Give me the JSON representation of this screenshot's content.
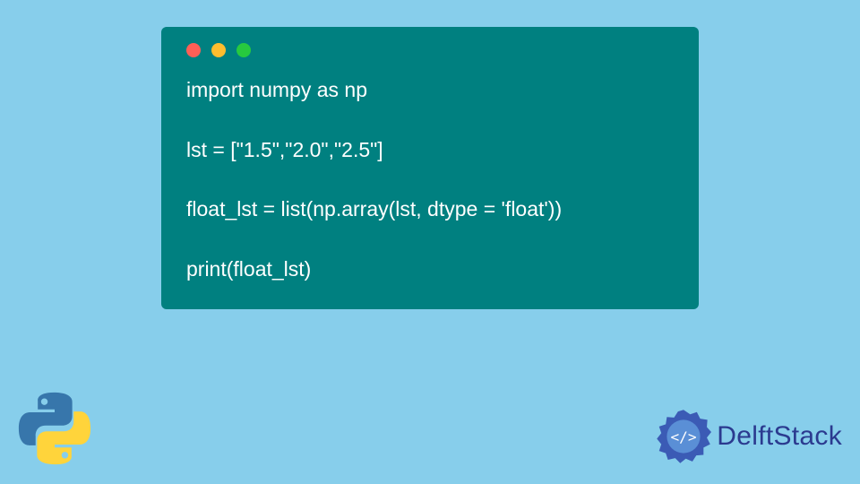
{
  "code": {
    "line1": "import numpy as np",
    "blank": "",
    "line2": "lst = [\"1.5\",\"2.0\",\"2.5\"]",
    "line3": "float_lst = list(np.array(lst, dtype = 'float'))",
    "line4": "print(float_lst)"
  },
  "branding": {
    "delftstack": "DelftStack"
  }
}
